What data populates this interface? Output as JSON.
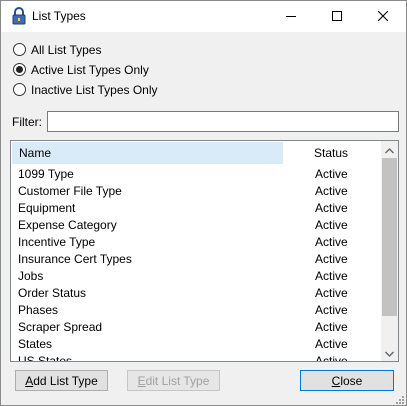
{
  "window": {
    "title": "List Types",
    "icon": "padlock-icon",
    "controls": {
      "minimize": "minimize-icon",
      "maximize": "maximize-icon",
      "close": "close-icon"
    }
  },
  "filter_options": [
    {
      "label": "All List Types",
      "checked": false
    },
    {
      "label": "Active List Types Only",
      "checked": true
    },
    {
      "label": "Inactive List Types Only",
      "checked": false
    }
  ],
  "filter": {
    "label": "Filter:",
    "value": ""
  },
  "list": {
    "columns": {
      "name": "Name",
      "status": "Status"
    },
    "rows": [
      {
        "name": "1099 Type",
        "status": "Active"
      },
      {
        "name": "Customer File Type",
        "status": "Active"
      },
      {
        "name": "Equipment",
        "status": "Active"
      },
      {
        "name": "Expense Category",
        "status": "Active"
      },
      {
        "name": "Incentive Type",
        "status": "Active"
      },
      {
        "name": "Insurance Cert Types",
        "status": "Active"
      },
      {
        "name": "Jobs",
        "status": "Active"
      },
      {
        "name": "Order Status",
        "status": "Active"
      },
      {
        "name": "Phases",
        "status": "Active"
      },
      {
        "name": "Scraper Spread",
        "status": "Active"
      },
      {
        "name": "States",
        "status": "Active"
      },
      {
        "name": "US States",
        "status": "Active"
      }
    ]
  },
  "buttons": {
    "add": {
      "mnemonic": "A",
      "rest": "dd List Type"
    },
    "edit": {
      "mnemonic": "E",
      "rest": "dit List Type",
      "disabled": true
    },
    "close": {
      "mnemonic": "C",
      "rest": "lose"
    }
  },
  "colors": {
    "header_highlight": "#d9ebf9",
    "scroll_thumb": "#c2c2c2",
    "default_button_border": "#0078d7"
  }
}
